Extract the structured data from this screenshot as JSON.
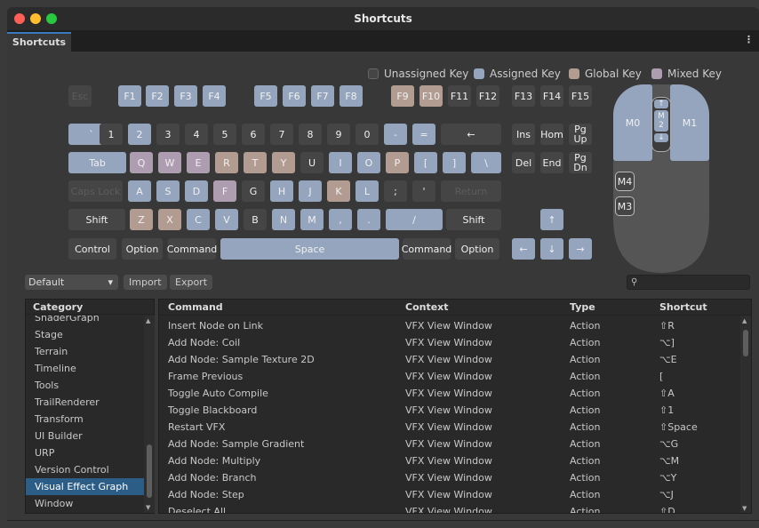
{
  "window": {
    "title": "Shortcuts",
    "tab_label": "Shortcuts",
    "menu_icon": "kebab-menu-icon"
  },
  "legend": [
    {
      "label": "Unassigned Key",
      "color": "#454545"
    },
    {
      "label": "Assigned Key",
      "color": "#95a5be"
    },
    {
      "label": "Global Key",
      "color": "#b29c92"
    },
    {
      "label": "Mixed Key",
      "color": "#ae9db0"
    }
  ],
  "colors": {
    "unassigned": "#454545",
    "assigned": "#95a5be",
    "global": "#b29c92",
    "mixed": "#ae9db0",
    "selection": "#2c5d87"
  },
  "keyboard": {
    "fn_row": [
      "Esc",
      "F1",
      "F2",
      "F3",
      "F4",
      "F5",
      "F6",
      "F7",
      "F8",
      "F9",
      "F10",
      "F11",
      "F12"
    ],
    "number_row": [
      "`",
      "1",
      "2",
      "3",
      "4",
      "5",
      "6",
      "7",
      "8",
      "9",
      "0",
      "-",
      "=",
      "←"
    ],
    "qwerty_row": [
      "Tab",
      "Q",
      "W",
      "E",
      "R",
      "T",
      "Y",
      "U",
      "I",
      "O",
      "P",
      "[",
      "]",
      "\\"
    ],
    "home_row": [
      "Caps Lock",
      "A",
      "S",
      "D",
      "F",
      "G",
      "H",
      "J",
      "K",
      "L",
      ";",
      "'",
      "Return"
    ],
    "shift_row": [
      "Shift",
      "Z",
      "X",
      "C",
      "V",
      "B",
      "N",
      "M",
      ",",
      ".",
      "/",
      "Shift"
    ],
    "bottom_row": [
      "Control",
      "Option",
      "Command",
      "Space",
      "Command",
      "Option"
    ],
    "nav_fn": [
      "F13",
      "F14",
      "F15"
    ],
    "nav_top": [
      "Ins",
      "Hom",
      "Pg\nUp"
    ],
    "nav_bottom": [
      "Del",
      "End",
      "Pg\nDn"
    ],
    "arrows": [
      "↑",
      "←",
      "↓",
      "→"
    ]
  },
  "mouse": {
    "left": "M0",
    "right": "M1",
    "middle": "M\n2",
    "wheel_up": "↑",
    "wheel_down": "↓",
    "side_top": "M4",
    "side_bottom": "M3"
  },
  "toolbar": {
    "profile": "Default",
    "import_label": "Import",
    "export_label": "Export",
    "search_placeholder": ""
  },
  "categories": {
    "header": "Category",
    "items": [
      "ShaderGraph",
      "Stage",
      "Terrain",
      "Timeline",
      "Tools",
      "TrailRenderer",
      "Transform",
      "UI Builder",
      "URP",
      "Version Control",
      "Visual Effect Graph",
      "Window"
    ],
    "selected": "Visual Effect Graph"
  },
  "table": {
    "columns": [
      "Command",
      "Context",
      "Type",
      "Shortcut"
    ],
    "rows": [
      [
        "Insert Node on Link",
        "VFX View Window",
        "Action",
        "⇧R"
      ],
      [
        "Add Node: Coil",
        "VFX View Window",
        "Action",
        "⌥]"
      ],
      [
        "Add Node: Sample Texture 2D",
        "VFX View Window",
        "Action",
        "⌥E"
      ],
      [
        "Frame Previous",
        "VFX View Window",
        "Action",
        "["
      ],
      [
        "Toggle Auto Compile",
        "VFX View Window",
        "Action",
        "⇧A"
      ],
      [
        "Toggle Blackboard",
        "VFX View Window",
        "Action",
        "⇧1"
      ],
      [
        "Restart VFX",
        "VFX View Window",
        "Action",
        "⇧Space"
      ],
      [
        "Add Node: Sample Gradient",
        "VFX View Window",
        "Action",
        "⌥G"
      ],
      [
        "Add Node: Multiply",
        "VFX View Window",
        "Action",
        "⌥M"
      ],
      [
        "Add Node: Branch",
        "VFX View Window",
        "Action",
        "⌥Y"
      ],
      [
        "Add Node: Step",
        "VFX View Window",
        "Action",
        "⌥J"
      ],
      [
        "Deselect All",
        "VFX View Window",
        "Action",
        "⇧D"
      ]
    ]
  }
}
